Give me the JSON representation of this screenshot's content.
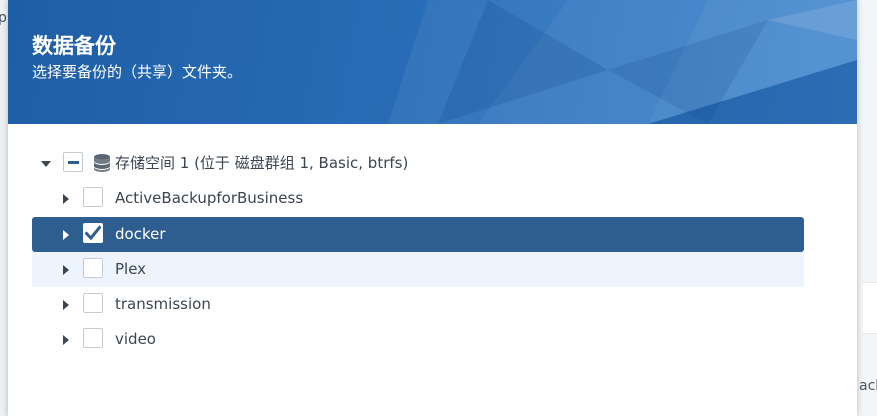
{
  "background": {
    "left_fragment": "p",
    "right_fragment": "ack"
  },
  "dialog": {
    "title": "数据备份",
    "subtitle": "选择要备份的（共享）文件夹。",
    "colors": {
      "header": "#2566b0",
      "selected_row": "#2e5d8f",
      "hover_row": "#edf4fd",
      "text": "#3b4651"
    }
  },
  "tree": {
    "root": {
      "label": "存储空间 1 (位于 磁盘群组 1, Basic, btrfs)",
      "expanded": true,
      "check_state": "partial",
      "icon": "database-icon"
    },
    "items": [
      {
        "label": "ActiveBackupforBusiness",
        "checked": false,
        "state": "normal"
      },
      {
        "label": "docker",
        "checked": true,
        "state": "selected"
      },
      {
        "label": "Plex",
        "checked": false,
        "state": "hover"
      },
      {
        "label": "transmission",
        "checked": false,
        "state": "normal"
      },
      {
        "label": "video",
        "checked": false,
        "state": "normal"
      }
    ]
  }
}
